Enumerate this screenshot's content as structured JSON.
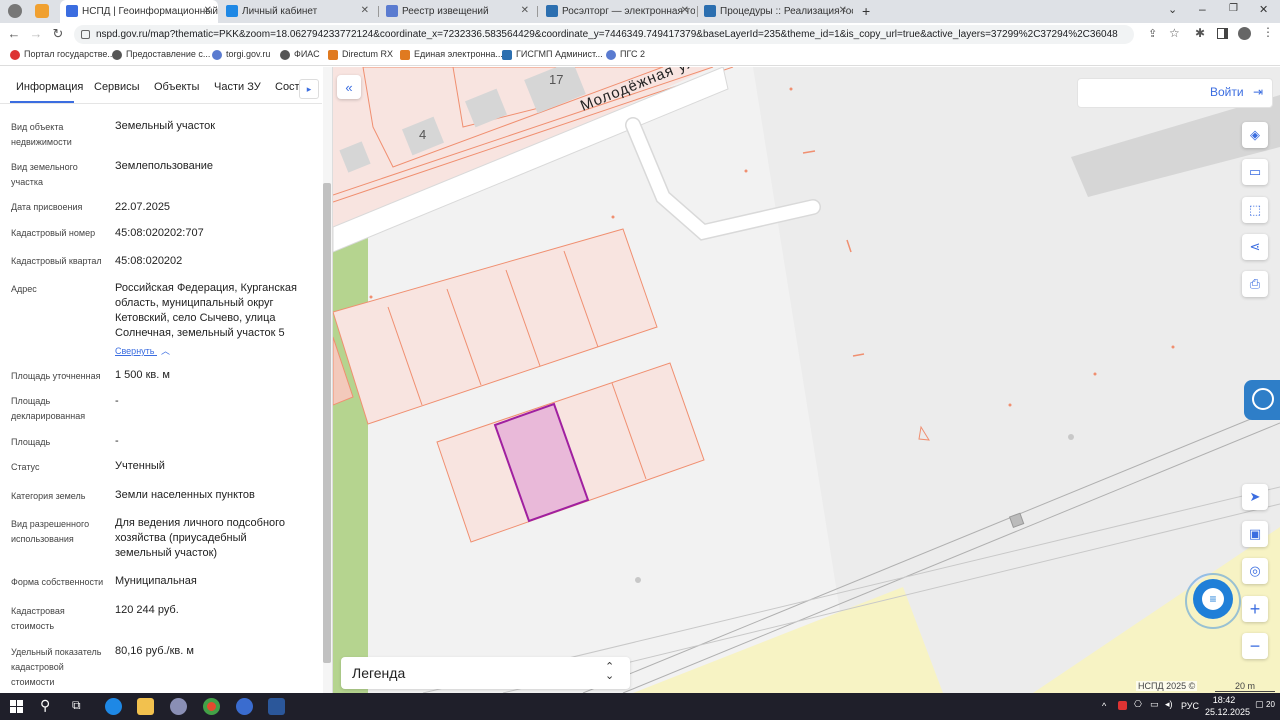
{
  "browser": {
    "tabs": [
      {
        "label": "НСПД | Геоинформационный п",
        "active": true
      },
      {
        "label": "Личный кабинет",
        "active": false
      },
      {
        "label": "Реестр извещений",
        "active": false
      },
      {
        "label": "Росэлторг — электронная торг",
        "active": false
      },
      {
        "label": "Процедуры :: Реализация госи",
        "active": false
      }
    ],
    "new_tab": "+",
    "url": "nspd.gov.ru/map?thematic=PKK&zoom=18.062794233772124&coordinate_x=7232336.583564429&coordinate_y=7446349.749417379&baseLayerId=235&theme_id=1&is_copy_url=true&active_layers=37299%2C37294%2C36048",
    "bookmarks": [
      "Портал государстве...",
      "Предоставление с...",
      "torgi.gov.ru",
      "ФИАС",
      "Directum RX",
      "Единая электронна...",
      "ГИСГМП Админист...",
      "ПГС 2"
    ]
  },
  "panel": {
    "tabs": [
      "Информация",
      "Сервисы",
      "Объекты",
      "Части ЗУ",
      "Соста"
    ],
    "fields": [
      {
        "label": "Вид объекта недвижимости",
        "value": "Земельный участок"
      },
      {
        "label": "Вид земельного участка",
        "value": "Землепользование"
      },
      {
        "label": "Дата присвоения",
        "value": "22.07.2025"
      },
      {
        "label": "Кадастровый номер",
        "value": "45:08:020202:707"
      },
      {
        "label": "Кадастровый квартал",
        "value": "45:08:020202"
      },
      {
        "label": "Адрес",
        "value": "Российская Федерация, Курганская область, муниципальный округ Кетовский, село Сычево, улица Солнечная, земельный участок 5"
      },
      {
        "label": "Площадь уточненная",
        "value": "1 500 кв. м"
      },
      {
        "label": "Площадь декларированная",
        "value": "-"
      },
      {
        "label": "Площадь",
        "value": "-"
      },
      {
        "label": "Статус",
        "value": "Учтенный"
      },
      {
        "label": "Категория земель",
        "value": "Земли населенных пунктов"
      },
      {
        "label": "Вид разрешенного использования",
        "value": "Для ведения личного подсобного хозяйства (приусадебный земельный участок)"
      },
      {
        "label": "Форма собственности",
        "value": "Муниципальная"
      },
      {
        "label": "Кадастровая стоимость",
        "value": "120 244 руб."
      },
      {
        "label": "Удельный показатель кадастровой стоимости",
        "value": "80,16 руб./кв. м"
      }
    ],
    "collapse_link": "Свернуть"
  },
  "map": {
    "street_label": "Молодёжная ули",
    "house_labels": [
      "17",
      "4"
    ],
    "login_button": "Войти",
    "legend_label": "Легенда",
    "copyright": "НСПД 2025 ©",
    "scale": "20 m",
    "selected_color": "#e9b9d9",
    "parcel_color": "#f08f70",
    "accent_color": "#3b6de0"
  },
  "taskbar": {
    "language": "РУС",
    "time": "18:42",
    "date": "25.12.2025",
    "notifications": "20"
  }
}
